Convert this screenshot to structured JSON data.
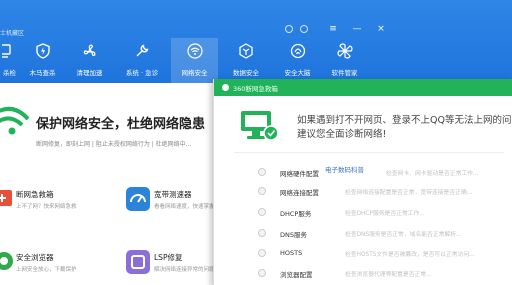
{
  "window": {
    "title_fragment": "士机藏区",
    "menu_glyph": "≡",
    "minimize_glyph": "—",
    "close_glyph": "×"
  },
  "toolbar": {
    "items": [
      {
        "label": "杀检",
        "icon": "computer-check-icon"
      },
      {
        "label": "木马查杀",
        "icon": "shield-icon"
      },
      {
        "label": "清理加速",
        "icon": "fan-icon"
      },
      {
        "label": "系统 · 急诊",
        "icon": "wrench-icon"
      },
      {
        "label": "网络安全",
        "icon": "wifi-icon",
        "active": true
      },
      {
        "label": "数据安全",
        "icon": "data-shield-icon"
      },
      {
        "label": "安全大脑",
        "icon": "brain-icon"
      },
      {
        "label": "软件管家",
        "icon": "apps-icon"
      }
    ],
    "active_label": "网络安全"
  },
  "hero": {
    "title": "保护网络安全，杜绝网络隐患",
    "subtitle": "断网修复，即刻上网  |  阻止未授权网络行为  |  杜绝网络中..."
  },
  "tiles": [
    {
      "name": "断网急救箱",
      "desc": "上不了网？快来网络急救",
      "color": "#e8503a"
    },
    {
      "name": "宽带测速器",
      "desc": "看看网络速度，快速掌握",
      "color": "#2c84d8"
    },
    {
      "name": "安全浏览器",
      "desc": "上网安全放心，下载保护",
      "color": "#2eaa4a"
    },
    {
      "name": "LSP修复",
      "desc": "解决网络连接异常的问题",
      "color": "#8a6fd6"
    }
  ],
  "popup": {
    "title": "360断网急救箱",
    "intro_line1": "如果遇到打不开网页、登录不上QQ等无法上网的问题，",
    "intro_line2": "建议您全面诊断网络!",
    "handwritten_note": "电子数码科普",
    "checks": [
      {
        "name": "网络硬件配置",
        "desc": "检查网卡、网卡驱动是否正常工作..."
      },
      {
        "name": "网络连接配置",
        "desc": "检查网络连接配置是否正常，宽带连接是否正确..."
      },
      {
        "name": "DHCP服务",
        "desc": "检查DHCP服务是否正常工作..."
      },
      {
        "name": "DNS服务",
        "desc": "检查DNS服务是否正常，域名能否正常解析..."
      },
      {
        "name": "HOSTS",
        "desc": "检查HOSTS文件是否被篡改，是否可以正常访问..."
      },
      {
        "name": "浏览器配置",
        "desc": "检查浏览器代理等配置是否正常..."
      }
    ]
  },
  "colors": {
    "toolbar_blue": "#1f74dc",
    "popup_green": "#21b25a",
    "accent_green": "#21b25a"
  }
}
